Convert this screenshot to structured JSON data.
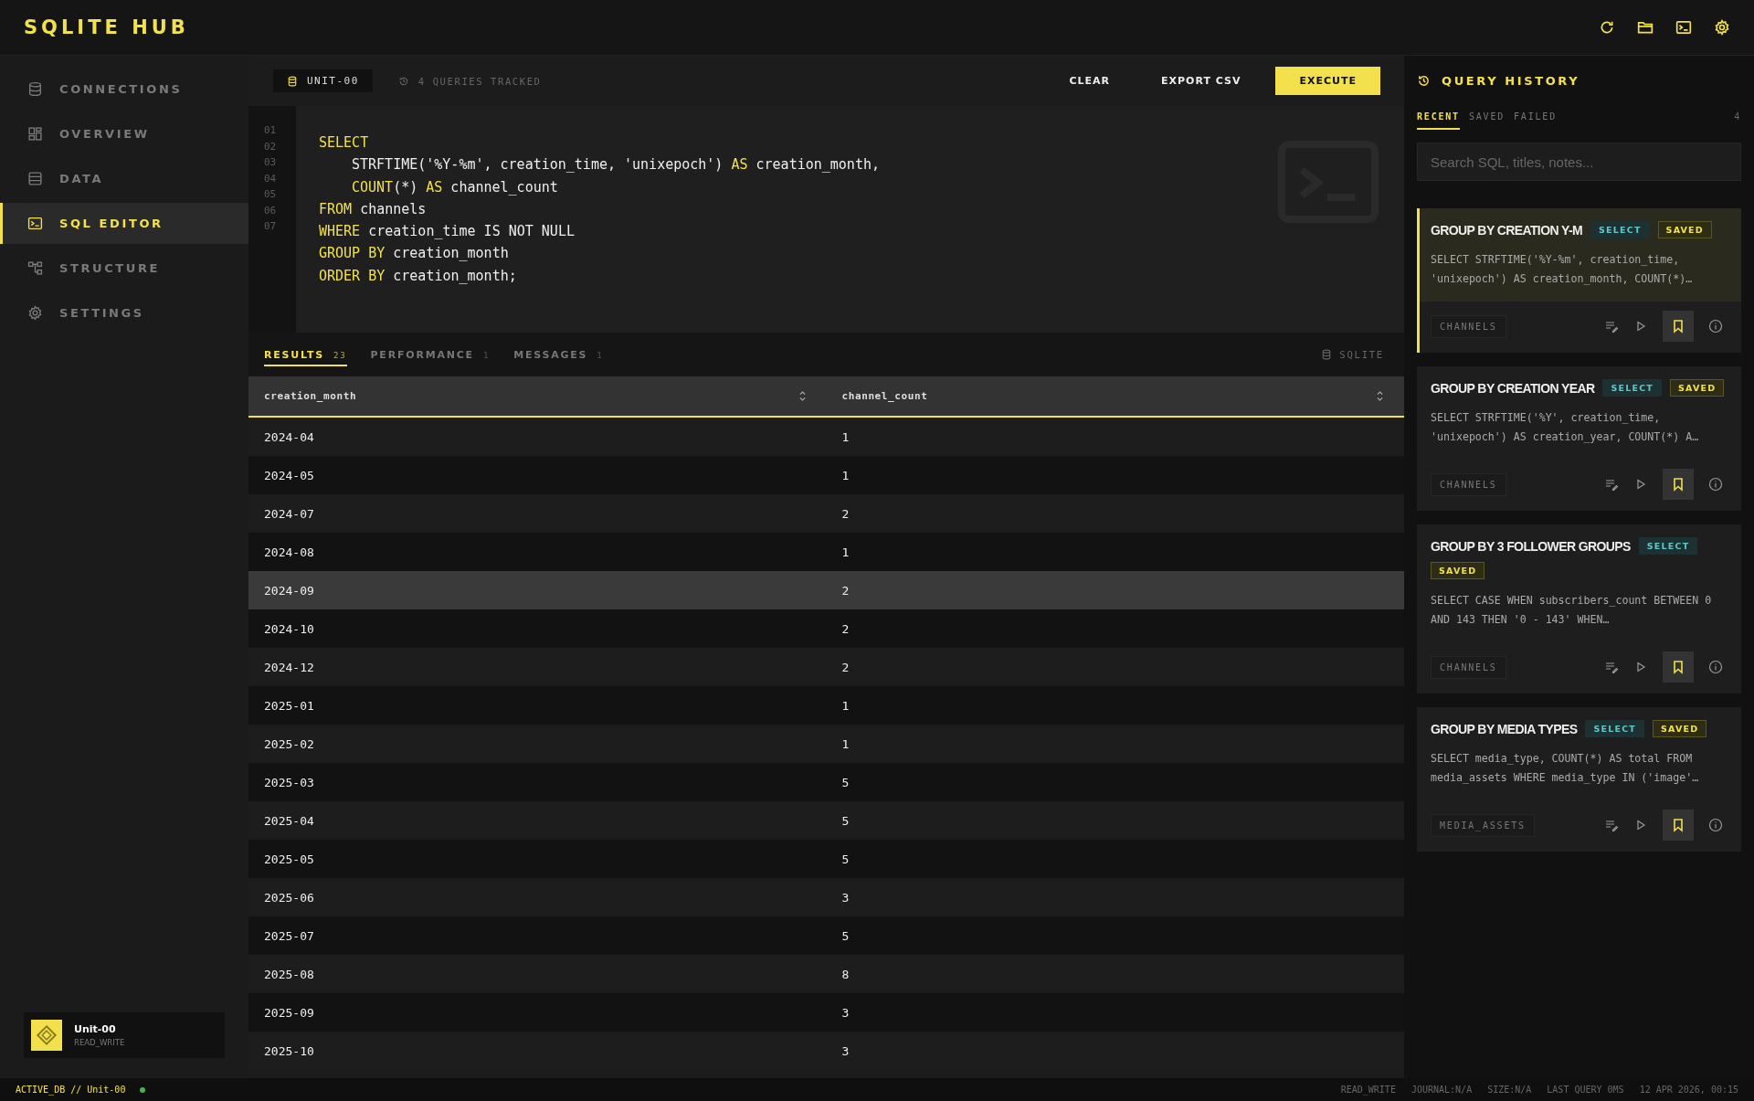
{
  "app": {
    "title": "SQLITE HUB"
  },
  "sidebar": {
    "items": [
      {
        "label": "CONNECTIONS",
        "selected": false
      },
      {
        "label": "OVERVIEW",
        "selected": false
      },
      {
        "label": "DATA",
        "selected": false
      },
      {
        "label": "SQL EDITOR",
        "selected": true
      },
      {
        "label": "STRUCTURE",
        "selected": false
      },
      {
        "label": "SETTINGS",
        "selected": false
      }
    ],
    "connection": {
      "name": "Unit-00",
      "mode": "READ_WRITE"
    }
  },
  "toolbar": {
    "database": "UNIT-00",
    "tracked": "4 QUERIES TRACKED",
    "buttons": [
      {
        "label": "CLEAR",
        "kind": "plain"
      },
      {
        "label": "EXPORT CSV",
        "kind": "plain"
      },
      {
        "label": "EXECUTE",
        "kind": "primary"
      }
    ]
  },
  "editor": {
    "line_numbers": [
      "01",
      "02",
      "03",
      "04",
      "05",
      "06",
      "07"
    ],
    "lines": [
      {
        "indented": false,
        "tokens": [
          {
            "text": "SELECT",
            "kind": "keyword"
          }
        ]
      },
      {
        "indented": true,
        "tokens": [
          {
            "text": "STRFTIME('%Y-%m', creation_time, 'unixepoch') ",
            "kind": "plain"
          },
          {
            "text": "AS",
            "kind": "keyword"
          },
          {
            "text": " creation_month,",
            "kind": "plain"
          }
        ]
      },
      {
        "indented": true,
        "tokens": [
          {
            "text": "COUNT",
            "kind": "keyword"
          },
          {
            "text": "(*) ",
            "kind": "plain"
          },
          {
            "text": "AS",
            "kind": "keyword"
          },
          {
            "text": " channel_count",
            "kind": "plain"
          }
        ]
      },
      {
        "indented": false,
        "tokens": [
          {
            "text": "FROM",
            "kind": "keyword"
          },
          {
            "text": " channels",
            "kind": "plain"
          }
        ]
      },
      {
        "indented": false,
        "tokens": [
          {
            "text": "WHERE",
            "kind": "keyword"
          },
          {
            "text": " creation_time IS NOT NULL",
            "kind": "plain"
          }
        ]
      },
      {
        "indented": false,
        "tokens": [
          {
            "text": "GROUP BY",
            "kind": "keyword"
          },
          {
            "text": " creation_month",
            "kind": "plain"
          }
        ]
      },
      {
        "indented": false,
        "tokens": [
          {
            "text": "ORDER BY",
            "kind": "keyword"
          },
          {
            "text": " creation_month;",
            "kind": "plain"
          }
        ]
      }
    ]
  },
  "results": {
    "tabs": [
      {
        "label": "RESULTS",
        "count": "23",
        "selected": true
      },
      {
        "label": "PERFORMANCE",
        "count": "1",
        "selected": false
      },
      {
        "label": "MESSAGES",
        "count": "1",
        "selected": false
      }
    ],
    "engine": "SQLITE",
    "table": {
      "columns": [
        "creation_month",
        "channel_count"
      ],
      "rows": [
        {
          "cells": [
            "2024-04",
            "1"
          ],
          "selected": false
        },
        {
          "cells": [
            "2024-05",
            "1"
          ],
          "selected": false
        },
        {
          "cells": [
            "2024-07",
            "2"
          ],
          "selected": false
        },
        {
          "cells": [
            "2024-08",
            "1"
          ],
          "selected": false
        },
        {
          "cells": [
            "2024-09",
            "2"
          ],
          "selected": true
        },
        {
          "cells": [
            "2024-10",
            "2"
          ],
          "selected": false
        },
        {
          "cells": [
            "2024-12",
            "2"
          ],
          "selected": false
        },
        {
          "cells": [
            "2025-01",
            "1"
          ],
          "selected": false
        },
        {
          "cells": [
            "2025-02",
            "1"
          ],
          "selected": false
        },
        {
          "cells": [
            "2025-03",
            "5"
          ],
          "selected": false
        },
        {
          "cells": [
            "2025-04",
            "5"
          ],
          "selected": false
        },
        {
          "cells": [
            "2025-05",
            "5"
          ],
          "selected": false
        },
        {
          "cells": [
            "2025-06",
            "3"
          ],
          "selected": false
        },
        {
          "cells": [
            "2025-07",
            "5"
          ],
          "selected": false
        },
        {
          "cells": [
            "2025-08",
            "8"
          ],
          "selected": false
        },
        {
          "cells": [
            "2025-09",
            "3"
          ],
          "selected": false
        },
        {
          "cells": [
            "2025-10",
            "3"
          ],
          "selected": false
        }
      ]
    }
  },
  "history": {
    "title": "QUERY HISTORY",
    "tabs": [
      {
        "label": "RECENT",
        "selected": true
      },
      {
        "label": "SAVED",
        "selected": false
      },
      {
        "label": "FAILED",
        "selected": false
      }
    ],
    "count": "4",
    "search": {
      "placeholder": "Search SQL, titles, notes..."
    },
    "items": [
      {
        "title": "GROUP BY CREATION Y-M",
        "type": "SELECT",
        "status": "SAVED",
        "sql": "SELECT STRFTIME('%Y-%m', creation_time, 'unixepoch') AS creation_month, COUNT(*)…",
        "table": "CHANNELS",
        "selected": true,
        "bookmarked": true
      },
      {
        "title": "GROUP BY CREATION YEAR",
        "type": "SELECT",
        "status": "SAVED",
        "sql": "SELECT STRFTIME('%Y', creation_time, 'unixepoch') AS creation_year, COUNT(*) A…",
        "table": "CHANNELS",
        "selected": false,
        "bookmarked": true
      },
      {
        "title": "GROUP BY 3 FOLLOWER GROUPS",
        "type": "SELECT",
        "status": "SAVED",
        "sql": "SELECT CASE WHEN subscribers_count BETWEEN 0 AND 143 THEN '0 - 143' WHEN…",
        "table": "CHANNELS",
        "selected": false,
        "bookmarked": true
      },
      {
        "title": "GROUP BY MEDIA TYPES",
        "type": "SELECT",
        "status": "SAVED",
        "sql": "SELECT media_type, COUNT(*) AS total FROM media_assets WHERE media_type IN ('image'…",
        "table": "MEDIA_ASSETS",
        "selected": false,
        "bookmarked": true
      }
    ]
  },
  "status_bar": {
    "active": "ACTIVE_DB // Unit-00",
    "online": true,
    "items": [
      "READ_WRITE",
      "JOURNAL:N/A",
      "SIZE:N/A",
      "LAST QUERY 0MS",
      "12 APR 2026, 00:15"
    ]
  }
}
